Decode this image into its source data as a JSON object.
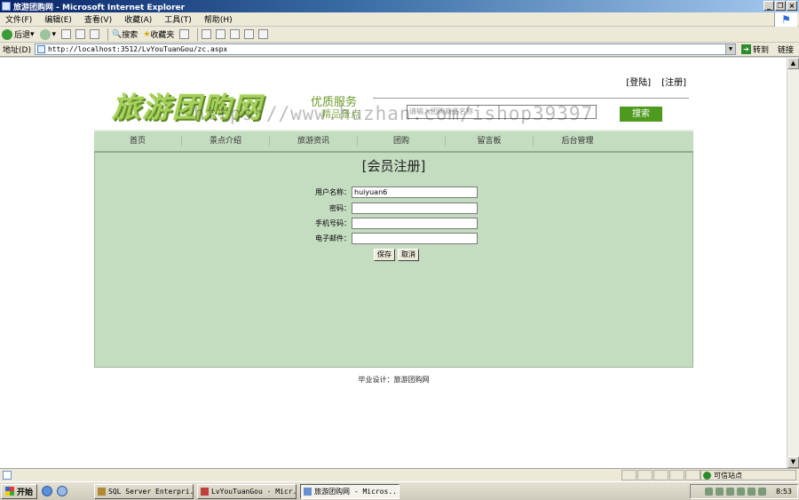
{
  "window": {
    "title": "旅游团购网 - Microsoft Internet Explorer"
  },
  "menubar": {
    "items": [
      "文件(F)",
      "编辑(E)",
      "查看(V)",
      "收藏(A)",
      "工具(T)",
      "帮助(H)"
    ]
  },
  "toolbar": {
    "back": "后退",
    "search": "搜索",
    "favorites": "收藏夹"
  },
  "addressbar": {
    "label": "地址(D)",
    "url": "http://localhost:3512/LvYouTuanGou/zc.aspx",
    "go": "转到",
    "links": "链接"
  },
  "site": {
    "login": "[登陆]",
    "register": "[注册]",
    "logo": "旅游团购网",
    "slogan_line1": "优质服务",
    "slogan_line2": "精品景点",
    "search_placeholder": "请输入团购商品名称",
    "search_button": "搜索",
    "watermark": "https://www.huzhan.com/ishop39397",
    "nav": [
      "首页",
      "景点介绍",
      "旅游资讯",
      "团购",
      "留言板",
      "后台管理"
    ]
  },
  "form": {
    "heading": "[会员注册]",
    "fields": [
      {
        "label": "用户名称：",
        "value": "huiyuan6"
      },
      {
        "label": "密码：",
        "value": ""
      },
      {
        "label": "手机号码：",
        "value": ""
      },
      {
        "label": "电子邮件：",
        "value": ""
      }
    ],
    "save": "保存",
    "cancel": "取消"
  },
  "footer": {
    "text": "毕业设计：旅游团购网"
  },
  "statusbar": {
    "zone": "可信站点"
  },
  "taskbar": {
    "start": "开始",
    "tasks": [
      {
        "label": "SQL Server Enterpri...",
        "active": false
      },
      {
        "label": "LvYouTuanGou - Micr...",
        "active": false
      },
      {
        "label": "旅游团购网 - Micros...",
        "active": true
      }
    ],
    "clock": "8:53"
  }
}
